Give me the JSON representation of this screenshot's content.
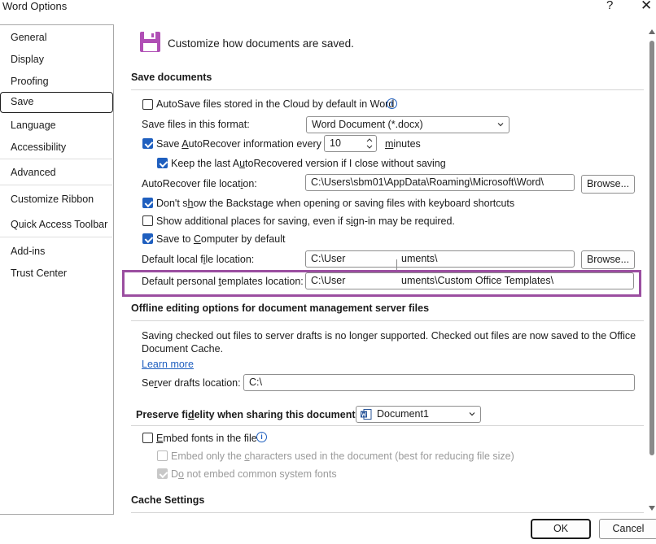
{
  "window": {
    "title": "Word Options",
    "help_symbol": "?",
    "close_symbol": "✕"
  },
  "sidebar": {
    "items": [
      {
        "label": "General"
      },
      {
        "label": "Display"
      },
      {
        "label": "Proofing"
      },
      {
        "label": "Save",
        "selected": true
      },
      {
        "label": "Language"
      },
      {
        "label": "Accessibility"
      },
      {
        "label": "Advanced"
      },
      {
        "label": "Customize Ribbon"
      },
      {
        "label": "Quick Access Toolbar"
      },
      {
        "label": "Add-ins"
      },
      {
        "label": "Trust Center"
      }
    ]
  },
  "header": {
    "text": "Customize how documents are saved.",
    "icon": "floppy-disk-icon"
  },
  "save_documents": {
    "heading": "Save documents",
    "autosave_cloud": {
      "label": "AutoSave files stored in the Cloud by default in Word",
      "checked": false
    },
    "format": {
      "label": "Save files in this format:",
      "value": "Word Document (*.docx)"
    },
    "autorecover": {
      "label": "Save AutoRecover information every",
      "checked": true,
      "value": "10",
      "unit": "minutes"
    },
    "keep_last": {
      "label": "Keep the last AutoRecovered version if I close without saving",
      "checked": true
    },
    "autorecover_location": {
      "label": "AutoRecover file location:",
      "value": "C:\\Users\\sbm01\\AppData\\Roaming\\Microsoft\\Word\\",
      "browse": "Browse..."
    },
    "dont_show_backstage": {
      "label": "Don't show the Backstage when opening or saving files with keyboard shortcuts",
      "checked": true
    },
    "show_additional": {
      "label": "Show additional places for saving, even if sign-in may be required.",
      "checked": false
    },
    "save_to_computer": {
      "label": "Save to Computer by default",
      "checked": true
    },
    "default_local": {
      "label": "Default local file location:",
      "value_left": "C:\\User",
      "value_right": "uments\\",
      "browse": "Browse..."
    },
    "default_templates": {
      "label": "Default personal templates location:",
      "value_left": "C:\\User",
      "value_right": "uments\\Custom Office Templates\\"
    }
  },
  "offline": {
    "heading": "Offline editing options for document management server files",
    "note": "Saving checked out files to server drafts is no longer supported. Checked out files are now saved to the Office",
    "note_line2": "Document Cache.",
    "learn_more": "Learn more",
    "server_drafts": {
      "label": "Server drafts location:",
      "value": "C:\\"
    }
  },
  "fidelity": {
    "heading": "Preserve fidelity when sharing this document:",
    "document": "Document1",
    "embed_fonts": {
      "label": "Embed fonts in the file",
      "checked": false
    },
    "embed_only_used": {
      "label": "Embed only the characters used in the document (best for reducing file size)",
      "checked": false
    },
    "do_not_embed_common": {
      "label": "Do not embed common system fonts",
      "checked": true
    }
  },
  "cache": {
    "heading": "Cache Settings"
  },
  "footer": {
    "ok": "OK",
    "cancel": "Cancel"
  },
  "colors": {
    "accent": "#1f5fbf",
    "highlight": "#9b4ea0"
  }
}
